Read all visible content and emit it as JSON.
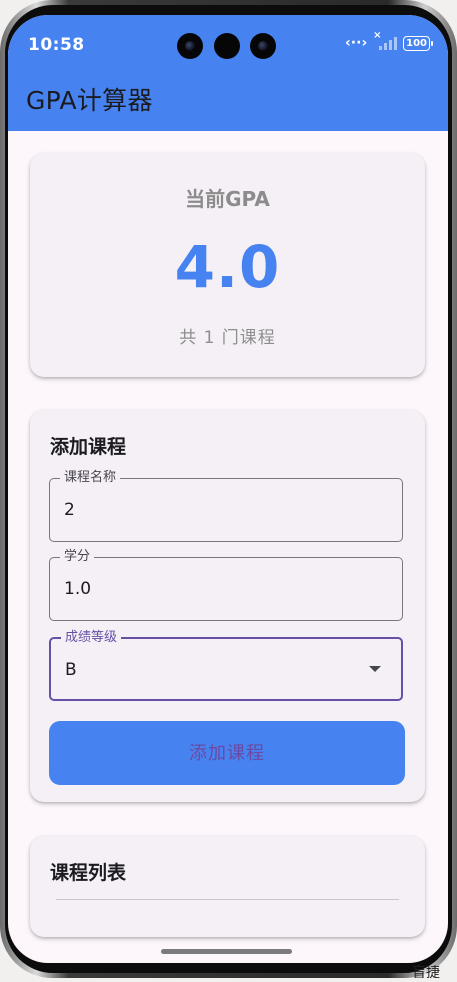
{
  "status_bar": {
    "time": "10:58",
    "battery": "100",
    "icons": [
      "nfc-icon",
      "signal-icon",
      "battery-icon"
    ]
  },
  "app_bar": {
    "title": "GPA计算器"
  },
  "gpa_card": {
    "label": "当前GPA",
    "value": "4.0",
    "course_count_text": "共 1 门课程"
  },
  "add_course": {
    "title": "添加课程",
    "course_name": {
      "label": "课程名称",
      "value": "2"
    },
    "credit": {
      "label": "学分",
      "value": "1.0"
    },
    "grade": {
      "label": "成绩等级",
      "value": "B",
      "icon": "dropdown-arrow-icon"
    },
    "submit_label": "添加课程"
  },
  "course_list": {
    "title": "课程列表"
  },
  "corner_text": "盲捷",
  "colors": {
    "primary": "#4683f1",
    "focus": "#6750a4",
    "surface": "#f5f0f6",
    "background": "#fdf7fc"
  }
}
